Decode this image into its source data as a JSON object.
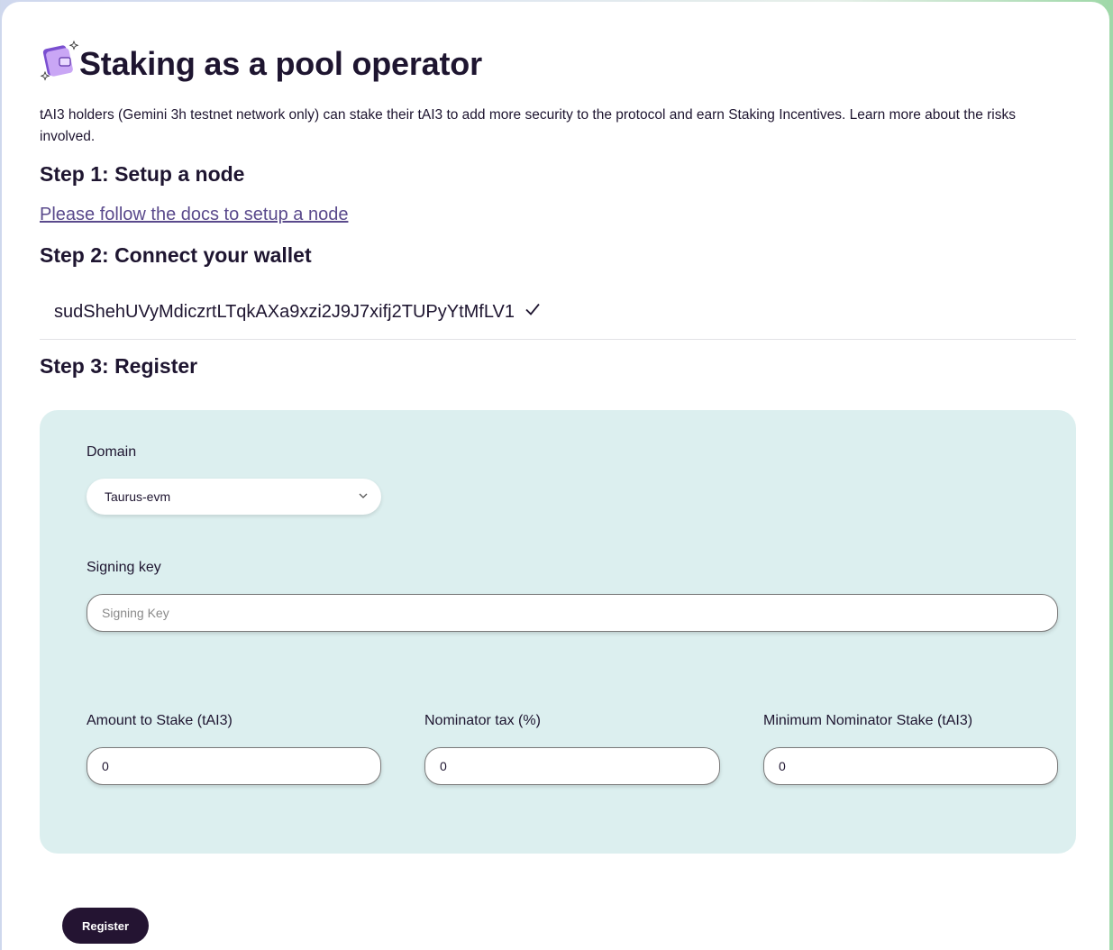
{
  "header": {
    "title": "Staking as a pool operator",
    "intro": "tAI3 holders (Gemini 3h testnet network only) can stake their tAI3 to add more security to the protocol and earn Staking Incentives. Learn more about the risks involved."
  },
  "step1": {
    "heading": "Step 1: Setup a node",
    "link_text": "Please follow the docs to setup a node"
  },
  "step2": {
    "heading": "Step 2: Connect your wallet",
    "wallet_address": "sudShehUVyMdiczrtLTqkAXa9xzi2J9J7xifj2TUPyYtMfLV1"
  },
  "step3": {
    "heading": "Step 3: Register",
    "domain": {
      "label": "Domain",
      "selected": "Taurus-evm"
    },
    "signing_key": {
      "label": "Signing key",
      "placeholder": "Signing Key",
      "value": ""
    },
    "amount_to_stake": {
      "label": "Amount to Stake (tAI3)",
      "value": "0"
    },
    "nominator_tax": {
      "label": "Nominator tax (%)",
      "value": "0"
    },
    "minimum_nominator_stake": {
      "label": "Minimum Nominator Stake (tAI3)",
      "value": "0"
    },
    "register_label": "Register"
  },
  "icons": [
    "wallet-icon",
    "check-icon",
    "chevron-down-icon"
  ],
  "colors": {
    "primary": "#241432",
    "panel": "#dcefef",
    "link": "#5a4a8c",
    "text": "#1e1530"
  }
}
